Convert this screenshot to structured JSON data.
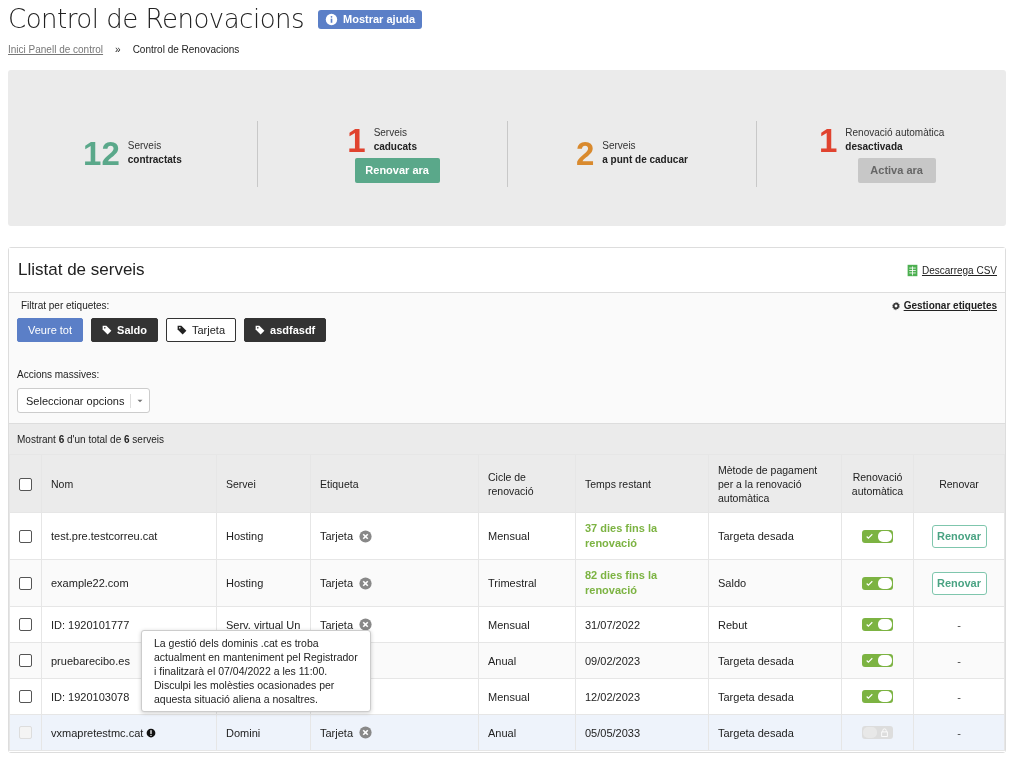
{
  "page": {
    "title": "Control de Renovacions",
    "help_button": "Mostrar ajuda"
  },
  "breadcrumb": [
    {
      "label": "Inici Panell de control",
      "link": true
    },
    {
      "label": "»",
      "link": false
    },
    {
      "label": "Control de Renovacions",
      "link": false
    }
  ],
  "stats": [
    {
      "number": "12",
      "color": "#5aa88a",
      "line1": "Serveis",
      "line2": "contractats"
    },
    {
      "number": "1",
      "color": "#e0432f",
      "line1": "Serveis",
      "line2": "caducats",
      "button": "Renovar ara",
      "button_disabled": false
    },
    {
      "number": "2",
      "color": "#d98a2e",
      "line1": "Serveis",
      "line2": "a punt de caducar"
    },
    {
      "number": "1",
      "color": "#e0432f",
      "line1": "Renovació automàtica",
      "line2": "desactivada",
      "button": "Activa ara",
      "button_disabled": true
    }
  ],
  "services": {
    "title": "Llistat de serveis",
    "csv_link": "Descarrega CSV",
    "filter_label": "Filtrat per etiquetes:",
    "manage_tags": "Gestionar etiquetes",
    "filters": [
      {
        "label": "Veure tot",
        "kind": "all",
        "selected": true
      },
      {
        "label": "Saldo",
        "kind": "tag",
        "selected": false,
        "dark": true
      },
      {
        "label": "Tarjeta",
        "kind": "tag",
        "selected": false,
        "dark": false
      },
      {
        "label": "asdfasdf",
        "kind": "tag",
        "selected": false,
        "dark": true
      }
    ],
    "bulk_label": "Accions massives:",
    "bulk_select": "Seleccionar opcions",
    "summary": "Mostrant **6** d'un total de **6** serveis",
    "table": {
      "select_all_checked": false,
      "columns": [
        "Nom",
        "Servei",
        "Etiqueta",
        "Cicle de renovació",
        "Temps restant",
        "Mètode de pagament per a la renovació automàtica",
        "Renovació automàtica",
        "Renovar"
      ],
      "rows": [
        {
          "checked": false,
          "disabled": false,
          "hovered": false,
          "name": "test.pre.testcorreu.cat",
          "service": "Hosting",
          "tag": "Tarjeta",
          "cycle": "Mensual",
          "remaining": "37 dies fins la renovació",
          "remaining_highlighted": true,
          "payment": "Targeta desada",
          "auto_on": true,
          "auto_disabled": false,
          "renew": "Renovar",
          "renew_button": true
        },
        {
          "checked": false,
          "disabled": false,
          "hovered": false,
          "name": "example22.com",
          "service": "Hosting",
          "tag": "Tarjeta",
          "cycle": "Trimestral",
          "remaining": "82 dies fins la renovació",
          "remaining_highlighted": true,
          "payment": "Saldo",
          "auto_on": true,
          "auto_disabled": false,
          "renew": "Renovar",
          "renew_button": true
        },
        {
          "checked": false,
          "disabled": false,
          "hovered": false,
          "name": "ID: 1920101777",
          "service": "Serv. virtual Un",
          "tag": "Tarjeta",
          "cycle": "Mensual",
          "remaining": "31/07/2022",
          "remaining_highlighted": false,
          "payment": "Rebut",
          "auto_on": true,
          "auto_disabled": false,
          "renew": "-",
          "renew_button": false
        },
        {
          "checked": false,
          "disabled": false,
          "hovered": false,
          "name": "pruebarecibo.es",
          "cycle": "Anual",
          "remaining": "09/02/2023",
          "remaining_highlighted": false,
          "payment": "Targeta desada",
          "auto_on": true,
          "auto_disabled": false,
          "renew": "-",
          "renew_button": false
        },
        {
          "checked": false,
          "disabled": false,
          "hovered": false,
          "name": "ID: 1920103078",
          "cycle": "Mensual",
          "remaining": "12/02/2023",
          "remaining_highlighted": false,
          "payment": "Targeta desada",
          "auto_on": true,
          "auto_disabled": false,
          "renew": "-",
          "renew_button": false
        },
        {
          "checked": false,
          "disabled": true,
          "hovered": true,
          "name": "vxmapretestmc.cat",
          "info": true,
          "service": "Domini",
          "tag": "Tarjeta",
          "cycle": "Anual",
          "remaining": "05/05/2033",
          "remaining_highlighted": false,
          "payment": "Targeta desada",
          "auto_on": false,
          "auto_disabled": true,
          "renew": "-",
          "renew_button": false
        }
      ]
    },
    "tooltip": "La gestió dels dominis .cat es troba actualment en manteniment pel Registrador i finalitzarà el 07/04/2022 a les 11:00. Disculpi les molèsties ocasionades per aquesta situació aliena a nosaltres."
  }
}
